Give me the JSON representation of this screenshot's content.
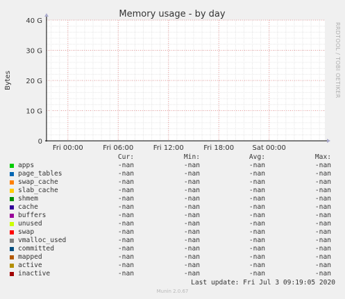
{
  "chart_data": {
    "type": "area",
    "title": "Memory usage - by day",
    "ylabel": "Bytes",
    "ylim": [
      0,
      40
    ],
    "y_ticks": [
      "0",
      "10 G",
      "20 G",
      "30 G",
      "40 G"
    ],
    "x_ticks": [
      "Fri 00:00",
      "Fri 06:00",
      "Fri 12:00",
      "Fri 18:00",
      "Sat 00:00"
    ],
    "grid": true,
    "side_label": "RRDTOOL / TOBI OETIKER",
    "series": [
      {
        "name": "apps",
        "color": "#00cc00",
        "values": []
      },
      {
        "name": "page_tables",
        "color": "#0066b3",
        "values": []
      },
      {
        "name": "swap_cache",
        "color": "#ff8000",
        "values": []
      },
      {
        "name": "slab_cache",
        "color": "#ffcc00",
        "values": []
      },
      {
        "name": "shmem",
        "color": "#008f00",
        "values": []
      },
      {
        "name": "cache",
        "color": "#330099",
        "values": []
      },
      {
        "name": "buffers",
        "color": "#990099",
        "values": []
      },
      {
        "name": "unused",
        "color": "#ccff00",
        "values": []
      },
      {
        "name": "swap",
        "color": "#ff0000",
        "values": []
      },
      {
        "name": "vmalloc_used",
        "color": "#808080",
        "values": []
      },
      {
        "name": "committed",
        "color": "#004d80",
        "values": []
      },
      {
        "name": "mapped",
        "color": "#b35a00",
        "values": []
      },
      {
        "name": "active",
        "color": "#b38f00",
        "values": []
      },
      {
        "name": "inactive",
        "color": "#a00000",
        "values": []
      }
    ]
  },
  "legend": {
    "headers": [
      "Cur:",
      "Min:",
      "Avg:",
      "Max:"
    ],
    "rows": [
      {
        "name": "apps",
        "color": "#00cc00",
        "cur": "-nan",
        "min": "-nan",
        "avg": "-nan",
        "max": "-nan"
      },
      {
        "name": "page_tables",
        "color": "#0066b3",
        "cur": "-nan",
        "min": "-nan",
        "avg": "-nan",
        "max": "-nan"
      },
      {
        "name": "swap_cache",
        "color": "#ff8000",
        "cur": "-nan",
        "min": "-nan",
        "avg": "-nan",
        "max": "-nan"
      },
      {
        "name": "slab_cache",
        "color": "#ffcc00",
        "cur": "-nan",
        "min": "-nan",
        "avg": "-nan",
        "max": "-nan"
      },
      {
        "name": "shmem",
        "color": "#008f00",
        "cur": "-nan",
        "min": "-nan",
        "avg": "-nan",
        "max": "-nan"
      },
      {
        "name": "cache",
        "color": "#330099",
        "cur": "-nan",
        "min": "-nan",
        "avg": "-nan",
        "max": "-nan"
      },
      {
        "name": "buffers",
        "color": "#990099",
        "cur": "-nan",
        "min": "-nan",
        "avg": "-nan",
        "max": "-nan"
      },
      {
        "name": "unused",
        "color": "#ccff00",
        "cur": "-nan",
        "min": "-nan",
        "avg": "-nan",
        "max": "-nan"
      },
      {
        "name": "swap",
        "color": "#ff0000",
        "cur": "-nan",
        "min": "-nan",
        "avg": "-nan",
        "max": "-nan"
      },
      {
        "name": "vmalloc_used",
        "color": "#808080",
        "cur": "-nan",
        "min": "-nan",
        "avg": "-nan",
        "max": "-nan"
      },
      {
        "name": "committed",
        "color": "#004d80",
        "cur": "-nan",
        "min": "-nan",
        "avg": "-nan",
        "max": "-nan"
      },
      {
        "name": "mapped",
        "color": "#b35a00",
        "cur": "-nan",
        "min": "-nan",
        "avg": "-nan",
        "max": "-nan"
      },
      {
        "name": "active",
        "color": "#b38f00",
        "cur": "-nan",
        "min": "-nan",
        "avg": "-nan",
        "max": "-nan"
      },
      {
        "name": "inactive",
        "color": "#a00000",
        "cur": "-nan",
        "min": "-nan",
        "avg": "-nan",
        "max": "-nan"
      }
    ]
  },
  "last_update": "Last update: Fri Jul  3 09:19:05 2020",
  "version": "Munin 2.0.67"
}
